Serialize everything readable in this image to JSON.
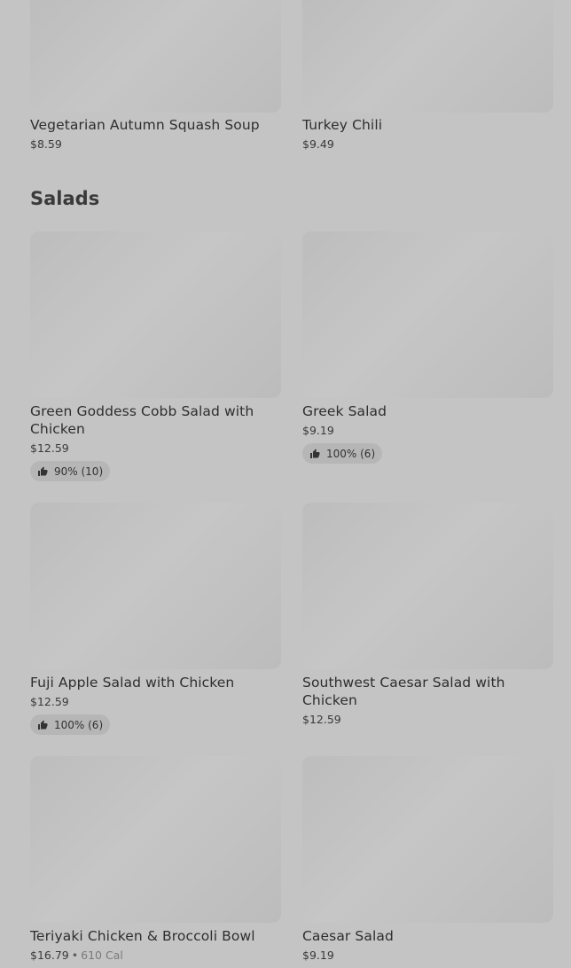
{
  "soups": [
    {
      "name": "Vegetarian Autumn Squash Soup",
      "price": "$8.59"
    },
    {
      "name": "Turkey Chili",
      "price": "$9.49"
    }
  ],
  "section": {
    "title": "Salads"
  },
  "salads": [
    {
      "name": "Green Goddess Cobb Salad with Chicken",
      "price": "$12.59",
      "rating": "90% (10)"
    },
    {
      "name": "Greek Salad",
      "price": "$9.19",
      "rating": "100% (6)"
    },
    {
      "name": "Fuji Apple Salad with Chicken",
      "price": "$12.59",
      "rating": "100% (6)"
    },
    {
      "name": "Southwest Caesar Salad with Chicken",
      "price": "$12.59"
    },
    {
      "name": "Teriyaki Chicken & Broccoli Bowl",
      "price": "$16.79",
      "separator": "•",
      "calories": "610 Cal"
    },
    {
      "name": "Caesar Salad",
      "price": "$9.19"
    }
  ],
  "icons": {
    "rating": "thumbs-up-icon"
  },
  "colors": {
    "overlay": "#c4c4c4",
    "image_placeholder": "#bdbdbd",
    "rating_pill": "#b6b6b6"
  }
}
